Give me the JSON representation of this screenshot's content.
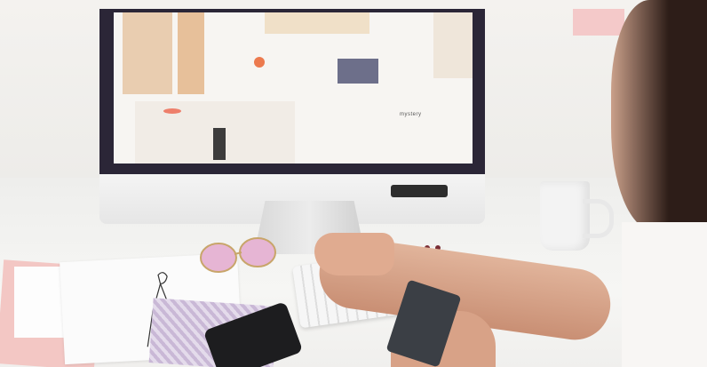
{
  "screen": {
    "site_heading": "mystery"
  },
  "colors": {
    "wall": "#f0eeeb",
    "desk": "#f2f2f0",
    "bezel": "#2b2637",
    "pink_paper": "#f3c7c4",
    "notebook": "#d4c5de",
    "card": "#3b3f45"
  }
}
